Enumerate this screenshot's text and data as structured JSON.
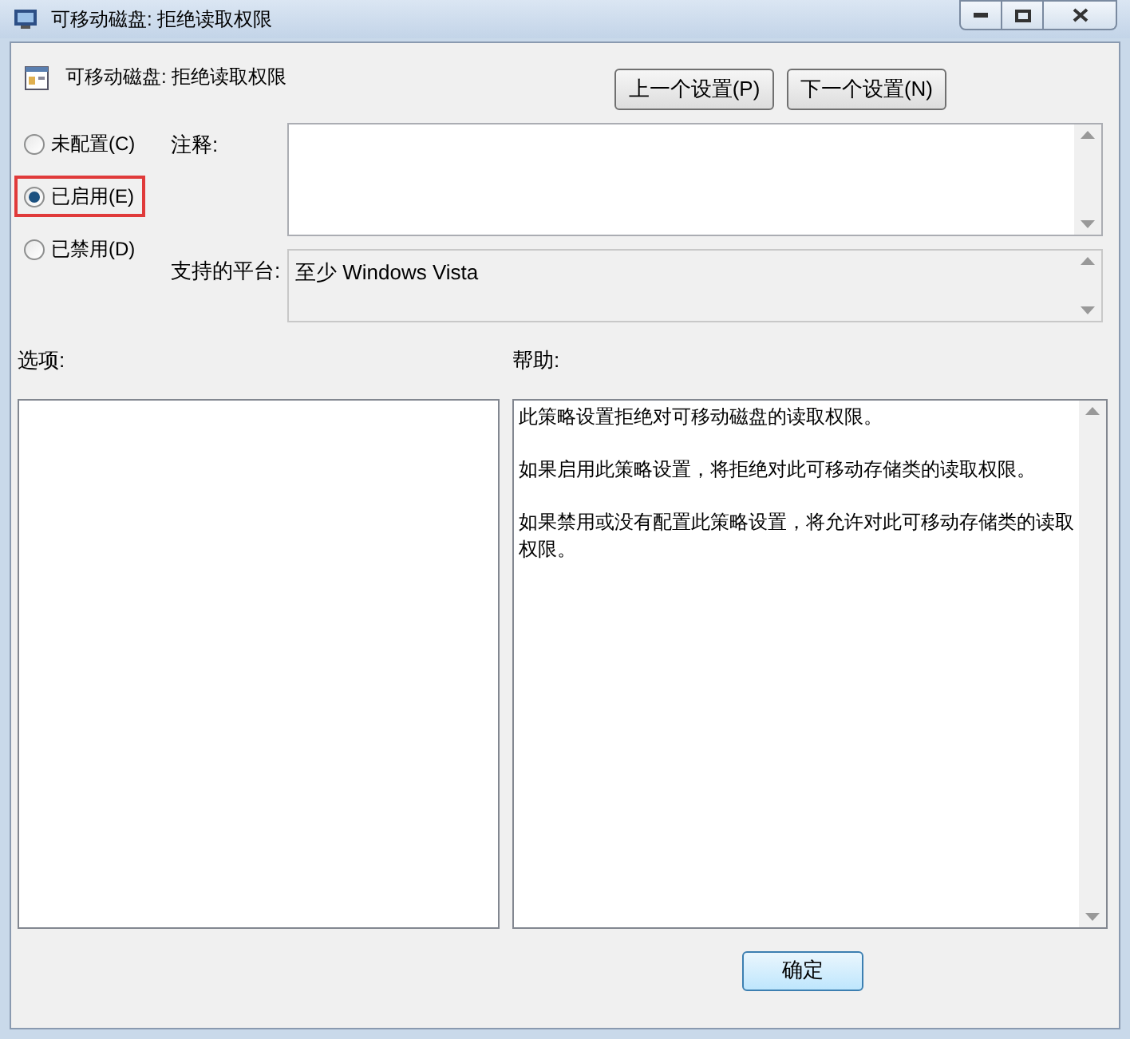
{
  "window": {
    "title": "可移动磁盘: 拒绝读取权限"
  },
  "header": {
    "title": "可移动磁盘: 拒绝读取权限"
  },
  "nav_buttons": [
    "上一个设置(P)",
    "下一个设置(N)"
  ],
  "options": [
    {
      "label": "未配置(C)",
      "selected": false,
      "highlighted": false
    },
    {
      "label": "已启用(E)",
      "selected": true,
      "highlighted": true
    },
    {
      "label": "已禁用(D)",
      "selected": false,
      "highlighted": false
    }
  ],
  "comment": {
    "label": "注释:"
  },
  "platform": {
    "label": "支持的平台:",
    "value": "至少 Windows Vista"
  },
  "options_label": "选项:",
  "help": {
    "label": "帮助:",
    "paragraphs": [
      "此策略设置拒绝对可移动磁盘的读取权限。",
      "如果启用此策略设置，将拒绝对此可移动存储类的读取权限。",
      "如果禁用或没有配置此策略设置，将允许对此可移动存储类的读取权限。"
    ]
  },
  "buttons": [
    "确定"
  ]
}
